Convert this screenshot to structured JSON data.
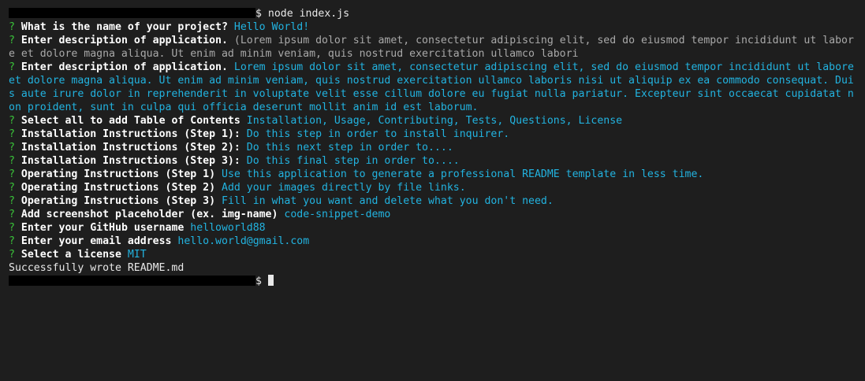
{
  "terminal": {
    "command_prompt": "$ node index.js",
    "final_prompt": "$",
    "qmark": "?",
    "prompts": [
      {
        "question": "What is the name of your project?",
        "answer": "Hello World!",
        "style": "answer"
      },
      {
        "question": "Enter description of application.",
        "answer": "(Lorem ipsum dolor sit amet, consectetur adipiscing elit, sed do eiusmod tempor incididunt ut labore et dolore magna aliqua. Ut enim ad minim veniam, quis nostrud exercitation ullamco labori",
        "style": "default"
      },
      {
        "question": "Enter description of application.",
        "answer": "Lorem ipsum dolor sit amet, consectetur adipiscing elit, sed do eiusmod tempor incididunt ut labore et dolore magna aliqua. Ut enim ad minim veniam, quis nostrud exercitation ullamco laboris nisi ut aliquip ex ea commodo consequat. Duis aute irure dolor in reprehenderit in voluptate velit esse cillum dolore eu fugiat nulla pariatur. Excepteur sint occaecat cupidatat non proident, sunt in culpa qui officia deserunt mollit anim id est laborum.",
        "style": "answer"
      },
      {
        "question": "Select all to add Table of Contents",
        "answer": "Installation, Usage, Contributing, Tests, Questions, License",
        "style": "answer"
      },
      {
        "question": "Installation Instructions (Step 1):",
        "answer": "Do this step in order to install inquirer.",
        "style": "answer"
      },
      {
        "question": "Installation Instructions (Step 2):",
        "answer": "Do this next step in order to....",
        "style": "answer"
      },
      {
        "question": "Installation Instructions (Step 3):",
        "answer": "Do this final step in order to....",
        "style": "answer"
      },
      {
        "question": "Operating Instructions (Step 1)",
        "answer": "Use this application to generate a professional README template in less time.",
        "style": "answer"
      },
      {
        "question": "Operating Instructions (Step 2)",
        "answer": "Add your images directly by file links.",
        "style": "answer"
      },
      {
        "question": "Operating Instructions (Step 3)",
        "answer": "Fill in what you want and delete what you don't need.",
        "style": "answer"
      },
      {
        "question": "Add screenshot placeholder (ex. img-name)",
        "answer": "code-snippet-demo",
        "style": "answer"
      },
      {
        "question": "Enter your GitHub username",
        "answer": "helloworld88",
        "style": "answer"
      },
      {
        "question": "Enter your email address",
        "answer": "hello.world@gmail.com",
        "style": "answer"
      },
      {
        "question": "Select a license",
        "answer": "MIT",
        "style": "answer"
      }
    ],
    "success_message": "Successfully wrote README.md"
  },
  "colors": {
    "background": "#1e1e1e",
    "prompt_mark": "#3ac23a",
    "answer": "#22b3e0",
    "default_answer": "#a9a9a9",
    "text": "#e8e8e8"
  }
}
